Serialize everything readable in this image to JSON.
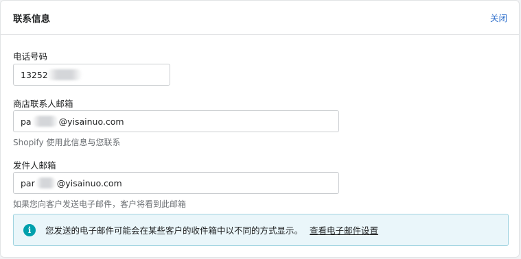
{
  "card": {
    "title": "联系信息",
    "close_label": "关闭"
  },
  "phone": {
    "label": "电话号码",
    "value": "13252"
  },
  "store_email": {
    "label": "商店联系人邮箱",
    "value_prefix": "pa",
    "value_suffix": "@yisainuo.com",
    "help": "Shopify 使用此信息与您联系"
  },
  "sender_email": {
    "label": "发件人邮箱",
    "value_prefix": "par",
    "value_suffix": "@yisainuo.com",
    "help": "如果您向客户发送电子邮件，客户将看到此邮箱"
  },
  "banner": {
    "icon": "info-icon",
    "text": "您发送的电子邮件可能会在某些客户的收件箱中以不同的方式显示。",
    "link_label": "查看电子邮件设置"
  }
}
